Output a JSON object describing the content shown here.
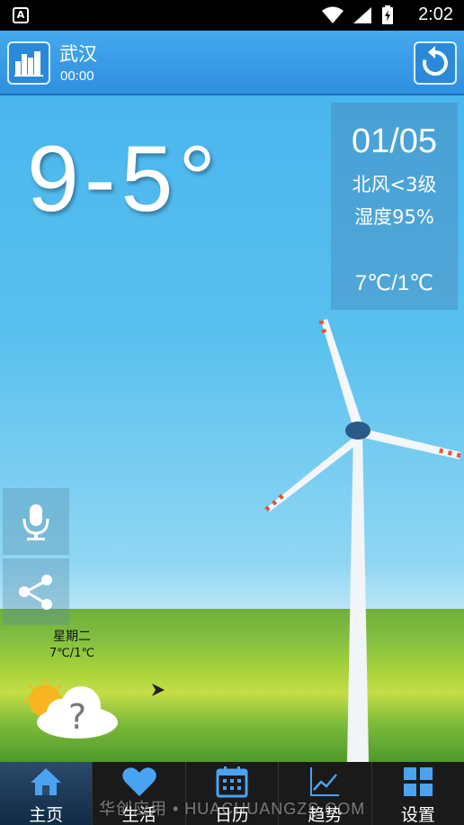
{
  "status_bar": {
    "app_badge": "A",
    "time": "2:02"
  },
  "header": {
    "city": "武汉",
    "update_time": "00:00"
  },
  "weather": {
    "temp_range": "9-5°",
    "date": "01/05",
    "wind": "北风<3级",
    "humidity": "湿度95%",
    "temp": "7℃/1℃"
  },
  "forecast": {
    "day": "星期二",
    "temp": "7℃/1℃",
    "icon": "partly-cloudy-unknown-icon"
  },
  "nav": {
    "items": [
      {
        "label": "主页",
        "icon": "home-icon"
      },
      {
        "label": "生活",
        "icon": "heart-icon"
      },
      {
        "label": "日历",
        "icon": "calendar-icon"
      },
      {
        "label": "趋势",
        "icon": "trend-chart-icon"
      },
      {
        "label": "设置",
        "icon": "grid-icon"
      }
    ]
  },
  "watermark": "华创应用 • HUACHUANGZS.COM",
  "colors": {
    "header": "#3a9de6",
    "nav_bg": "#1a1a1a",
    "nav_icon": "#4aa3f0"
  }
}
